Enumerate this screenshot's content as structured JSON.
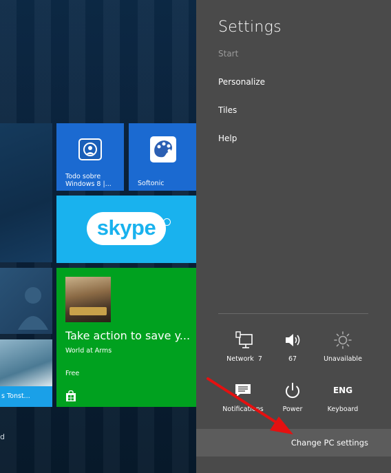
{
  "start_screen": {
    "tiles": {
      "todo_sobre": {
        "label": "Todo sobre\nWindows 8 |...",
        "icon": "app-bag-icon",
        "color": "#1b6ad1"
      },
      "softonic": {
        "label": "Softonic",
        "icon": "palette-icon",
        "color": "#1b6ad1"
      },
      "skype": {
        "label": "skype",
        "color": "#19b2ee"
      },
      "world_at_arms": {
        "headline": "Take action to save y...",
        "app_name": "World at Arms",
        "price": "Free",
        "color": "#00a11f",
        "store_icon": "store-bag-icon"
      },
      "partial_tile_bottom_left": {
        "label": "s Tonst..."
      }
    },
    "cut_off_text": "d"
  },
  "settings": {
    "title": "Settings",
    "context": "Start",
    "menu": [
      {
        "label": "Personalize"
      },
      {
        "label": "Tiles"
      },
      {
        "label": "Help"
      }
    ],
    "quick_settings": [
      {
        "label": "Network  7",
        "icon": "network-icon"
      },
      {
        "label": "67",
        "icon": "speaker-icon"
      },
      {
        "label": "Unavailable",
        "icon": "brightness-icon"
      },
      {
        "label": "Notifications",
        "icon": "notifications-icon"
      },
      {
        "label": "Power",
        "icon": "power-icon"
      },
      {
        "label": "Keyboard",
        "icon": "keyboard-icon",
        "glyph": "ENG"
      }
    ],
    "change_pc_settings": "Change PC settings",
    "colors": {
      "panel": "#4a4a4a",
      "highlight_bar": "#5c5c5c",
      "arrow": "#e51010"
    }
  }
}
